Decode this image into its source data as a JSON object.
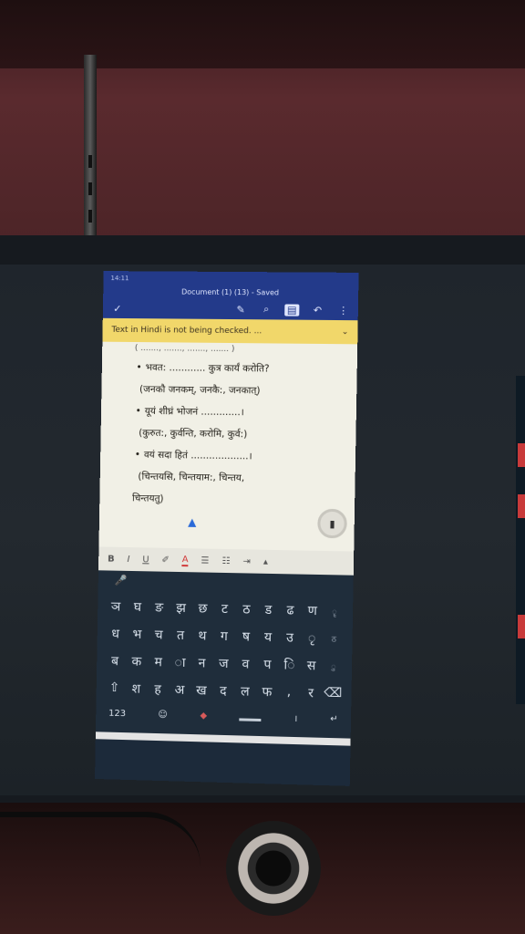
{
  "status_bar": {
    "time": "14:11",
    "right": ""
  },
  "title_bar": {
    "title": "Document (1) (13) - Saved"
  },
  "toolbar": {
    "check_icon": "✓",
    "pen_icon": "✎",
    "search_icon": "⌕",
    "reading_icon": "▤",
    "undo_icon": "↶",
    "more_icon": "⋮"
  },
  "banner": {
    "text": "Text in Hindi is not being checked. ...",
    "chevron": "⌄"
  },
  "document": {
    "cut_line": "( ......., ......., ......., ....... )",
    "lines": [
      "भवत: ............ कुत्र कार्यं करोति?",
      "(जनकौ जनकम्, जनकै:, जनकात्)",
      "यूयं शीघ्रं भोजनं .............।",
      "(कुरुत:, कुर्वन्ति, करोमि, कुर्व:)",
      "वयं सदा हितं ...................।",
      "(चिन्तयसि, चिन्तयाम:, चिन्तय,",
      "चिन्तयतु)"
    ]
  },
  "format_bar": {
    "bold": "B",
    "italic": "I",
    "underline": "U",
    "highlight": "✐",
    "font_color": "A",
    "bullets": "☰",
    "numbering": "☷",
    "indent": "⇥",
    "more": "▴"
  },
  "keyboard": {
    "mic": "🎤",
    "row1": [
      "ञ",
      "घ",
      "ङ",
      "झ",
      "छ",
      "ट",
      "ठ",
      "ड",
      "ढ",
      "ण"
    ],
    "row1_hint": "ॄ",
    "row2": [
      "ध",
      "भ",
      "च",
      "त",
      "थ",
      "ग",
      "ष",
      "य",
      "उ",
      "ृ"
    ],
    "row2_hint": "ठ",
    "row3": [
      "ब",
      "क",
      "म",
      "ा",
      "न",
      "ज",
      "व",
      "प",
      "ि",
      "स"
    ],
    "row3_hint": "ु",
    "row4": [
      "⇧",
      "श",
      "ह",
      "अ",
      "ख",
      "द",
      "ल",
      "फ",
      ",",
      "र",
      "⌫"
    ],
    "bottom": {
      "numbers": "123",
      "emoji": "☺",
      "period": "।",
      "enter": "↵"
    }
  }
}
